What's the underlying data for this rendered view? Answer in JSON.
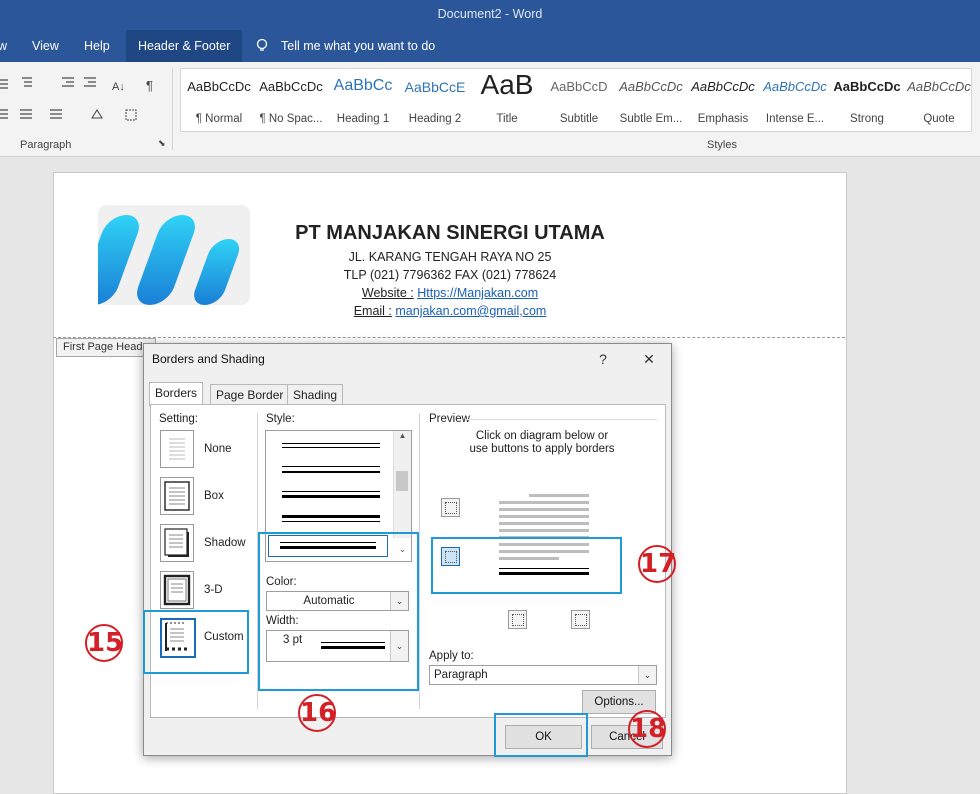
{
  "window": {
    "title": "Document2  -  Word"
  },
  "menu": {
    "partial": "w",
    "items": [
      "View",
      "Help",
      "Header & Footer"
    ],
    "tell_me": "Tell me what you want to do"
  },
  "ribbon": {
    "paragraph_group": "Paragraph",
    "styles_group": "Styles",
    "styles": [
      {
        "sample": "AaBbCcDc",
        "name": "¶ Normal"
      },
      {
        "sample": "AaBbCcDc",
        "name": "¶ No Spac..."
      },
      {
        "sample": "AaBbCc",
        "name": "Heading 1"
      },
      {
        "sample": "AaBbCcE",
        "name": "Heading 2"
      },
      {
        "sample": "AaB",
        "name": "Title"
      },
      {
        "sample": "AaBbCcD",
        "name": "Subtitle"
      },
      {
        "sample": "AaBbCcDc",
        "name": "Subtle Em..."
      },
      {
        "sample": "AaBbCcDc",
        "name": "Emphasis"
      },
      {
        "sample": "AaBbCcDc",
        "name": "Intense E..."
      },
      {
        "sample": "AaBbCcDc",
        "name": "Strong"
      },
      {
        "sample": "AaBbCcDc",
        "name": "Quote"
      }
    ]
  },
  "document": {
    "company": "PT MANJAKAN SINERGI UTAMA",
    "address": "JL. KARANG TENGAH RAYA NO 25",
    "phone": "TLP (021) 7796362 FAX (021) 778624",
    "website_label": "Website :",
    "website": "Https://Manjakan.com",
    "email_label": "Email :",
    "email": "manjakan.com@gmail,com",
    "header_tag": "First Page Header"
  },
  "dialog": {
    "title": "Borders and Shading",
    "help": "?",
    "close": "✕",
    "tabs": [
      "Borders",
      "Page Border",
      "Shading"
    ],
    "setting_label": "Setting:",
    "settings": [
      "None",
      "Box",
      "Shadow",
      "3-D",
      "Custom"
    ],
    "style_label": "Style:",
    "color_label": "Color:",
    "color_value": "Automatic",
    "width_label": "Width:",
    "width_value": "3 pt",
    "preview_label": "Preview",
    "preview_hint": "Click on diagram below or\nuse buttons to apply borders",
    "apply_to_label": "Apply to:",
    "apply_to_value": "Paragraph",
    "options_button": "Options...",
    "ok_button": "OK",
    "cancel_button": "Cancel"
  },
  "annotations": [
    "15",
    "16",
    "17",
    "18"
  ],
  "colors": {
    "word_blue": "#2b579a",
    "highlight_blue": "#1e9bd7",
    "annotation_red": "#d32027"
  }
}
